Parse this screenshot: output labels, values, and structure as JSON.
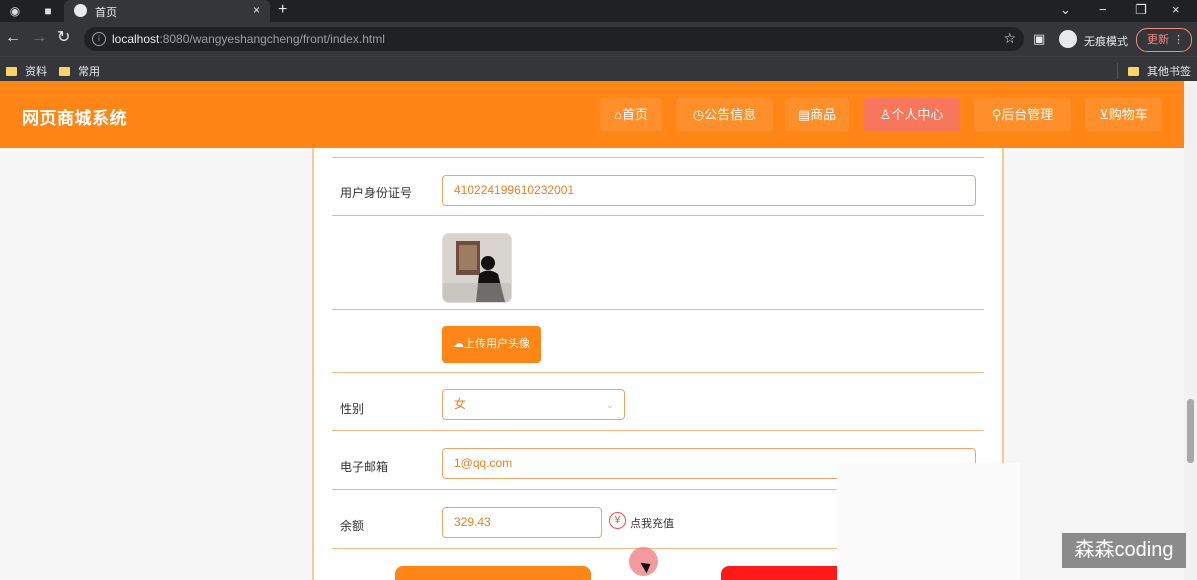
{
  "browser": {
    "tab_title": "首页",
    "url_host": "localhost",
    "url_path": ":8080/wangyeshangcheng/front/index.html",
    "incognito_label": "无痕模式",
    "update_label": "更新",
    "bookmarks": [
      "资料",
      "常用"
    ],
    "other_bookmarks": "其他书签"
  },
  "site": {
    "logo": "网页商城系统",
    "nav": [
      {
        "icon": "home-icon",
        "label": "首页"
      },
      {
        "icon": "announcement-icon",
        "label": "公告信息"
      },
      {
        "icon": "shop-icon",
        "label": "商品"
      },
      {
        "icon": "user-icon",
        "label": "个人中心"
      },
      {
        "icon": "link-icon",
        "label": "后台管理"
      },
      {
        "icon": "cart-icon",
        "label": "购物车"
      }
    ],
    "active_nav": "个人中心"
  },
  "form": {
    "id_label": "用户身份证号",
    "id_value": "410224199610232001",
    "upload_label": "上传用户头像",
    "gender_label": "性别",
    "gender_value": "女",
    "email_label": "电子邮箱",
    "email_value": "1@qq.com",
    "balance_label": "余额",
    "balance_value": "329.43",
    "recharge_label": "点我充值"
  },
  "watermark": "森森coding",
  "colors": {
    "brand_orange": "#ff8516",
    "active_nav": "#f8775c",
    "danger_red": "#ff1a1a"
  }
}
